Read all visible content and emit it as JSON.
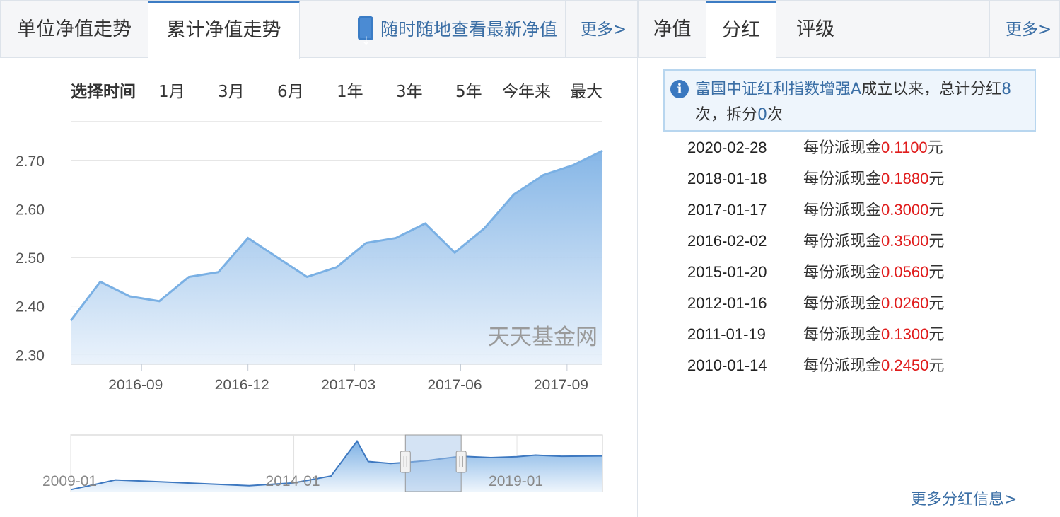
{
  "left_tabs": [
    "单位净值走势",
    "累计净值走势"
  ],
  "promo": "随时随地查看最新净值",
  "left_more": "更多>",
  "range": {
    "label": "选择时间",
    "options": [
      "1月",
      "3月",
      "6月",
      "1年",
      "3年",
      "5年",
      "今年来",
      "最大"
    ]
  },
  "watermark": "天天基金网",
  "right_tabs": [
    "净值",
    "分红",
    "评级"
  ],
  "right_more": "更多>",
  "dividend_info": {
    "fund": "富国中证红利指数增强A",
    "text1": "成立以来，总计分红",
    "count": "8",
    "text2": "次，拆分",
    "split": "0",
    "text3": "次"
  },
  "dividends": [
    {
      "date": "2020-02-28",
      "prefix": "每份派现金",
      "value": "0.1100",
      "unit": "元"
    },
    {
      "date": "2018-01-18",
      "prefix": "每份派现金",
      "value": "0.1880",
      "unit": "元"
    },
    {
      "date": "2017-01-17",
      "prefix": "每份派现金",
      "value": "0.3000",
      "unit": "元"
    },
    {
      "date": "2016-02-02",
      "prefix": "每份派现金",
      "value": "0.3500",
      "unit": "元"
    },
    {
      "date": "2015-01-20",
      "prefix": "每份派现金",
      "value": "0.0560",
      "unit": "元"
    },
    {
      "date": "2012-01-16",
      "prefix": "每份派现金",
      "value": "0.0260",
      "unit": "元"
    },
    {
      "date": "2011-01-19",
      "prefix": "每份派现金",
      "value": "0.1300",
      "unit": "元"
    },
    {
      "date": "2010-01-14",
      "prefix": "每份派现金",
      "value": "0.2450",
      "unit": "元"
    }
  ],
  "more_dividends": "更多分红信息>",
  "chart_data": [
    {
      "type": "area",
      "x_labels": [
        "2016-09",
        "2016-12",
        "2017-03",
        "2017-06",
        "2017-09"
      ],
      "x_range": [
        "2016-07",
        "2017-10"
      ],
      "ylim": [
        2.28,
        2.78
      ],
      "y_ticks": [
        "2.30",
        "2.40",
        "2.50",
        "2.60",
        "2.70"
      ],
      "grid": true,
      "series": [
        {
          "x": [
            "2016-07",
            "2016-08",
            "2016-09",
            "2016-10",
            "2016-11",
            "2016-11",
            "2016-12",
            "2016-12",
            "2017-01",
            "2017-02",
            "2017-03",
            "2017-04",
            "2017-05",
            "2017-05",
            "2017-06",
            "2017-07",
            "2017-08",
            "2017-09",
            "2017-10"
          ],
          "values": [
            2.37,
            2.45,
            2.42,
            2.41,
            2.46,
            2.47,
            2.54,
            2.5,
            2.46,
            2.48,
            2.53,
            2.54,
            2.57,
            2.51,
            2.56,
            2.63,
            2.67,
            2.69,
            2.72
          ]
        }
      ]
    },
    {
      "type": "area",
      "x_labels": [
        "2009-01",
        "2014-01",
        "2019-01"
      ],
      "x_range": [
        "2009-01",
        "2020-12"
      ],
      "selection": [
        "2016-07",
        "2017-10"
      ],
      "series": [
        {
          "x": [
            "2009-01",
            "2009-06",
            "2010-01",
            "2011-01",
            "2012-01",
            "2013-01",
            "2014-01",
            "2014-11",
            "2015-06",
            "2015-09",
            "2016-03",
            "2016-07",
            "2017-01",
            "2017-10",
            "2018-06",
            "2019-01",
            "2019-06",
            "2020-01",
            "2020-12"
          ],
          "values": [
            1.0,
            1.2,
            1.5,
            1.4,
            1.3,
            1.2,
            1.35,
            1.7,
            3.5,
            2.45,
            2.35,
            2.4,
            2.5,
            2.72,
            2.65,
            2.7,
            2.78,
            2.72,
            2.74
          ]
        }
      ]
    }
  ]
}
